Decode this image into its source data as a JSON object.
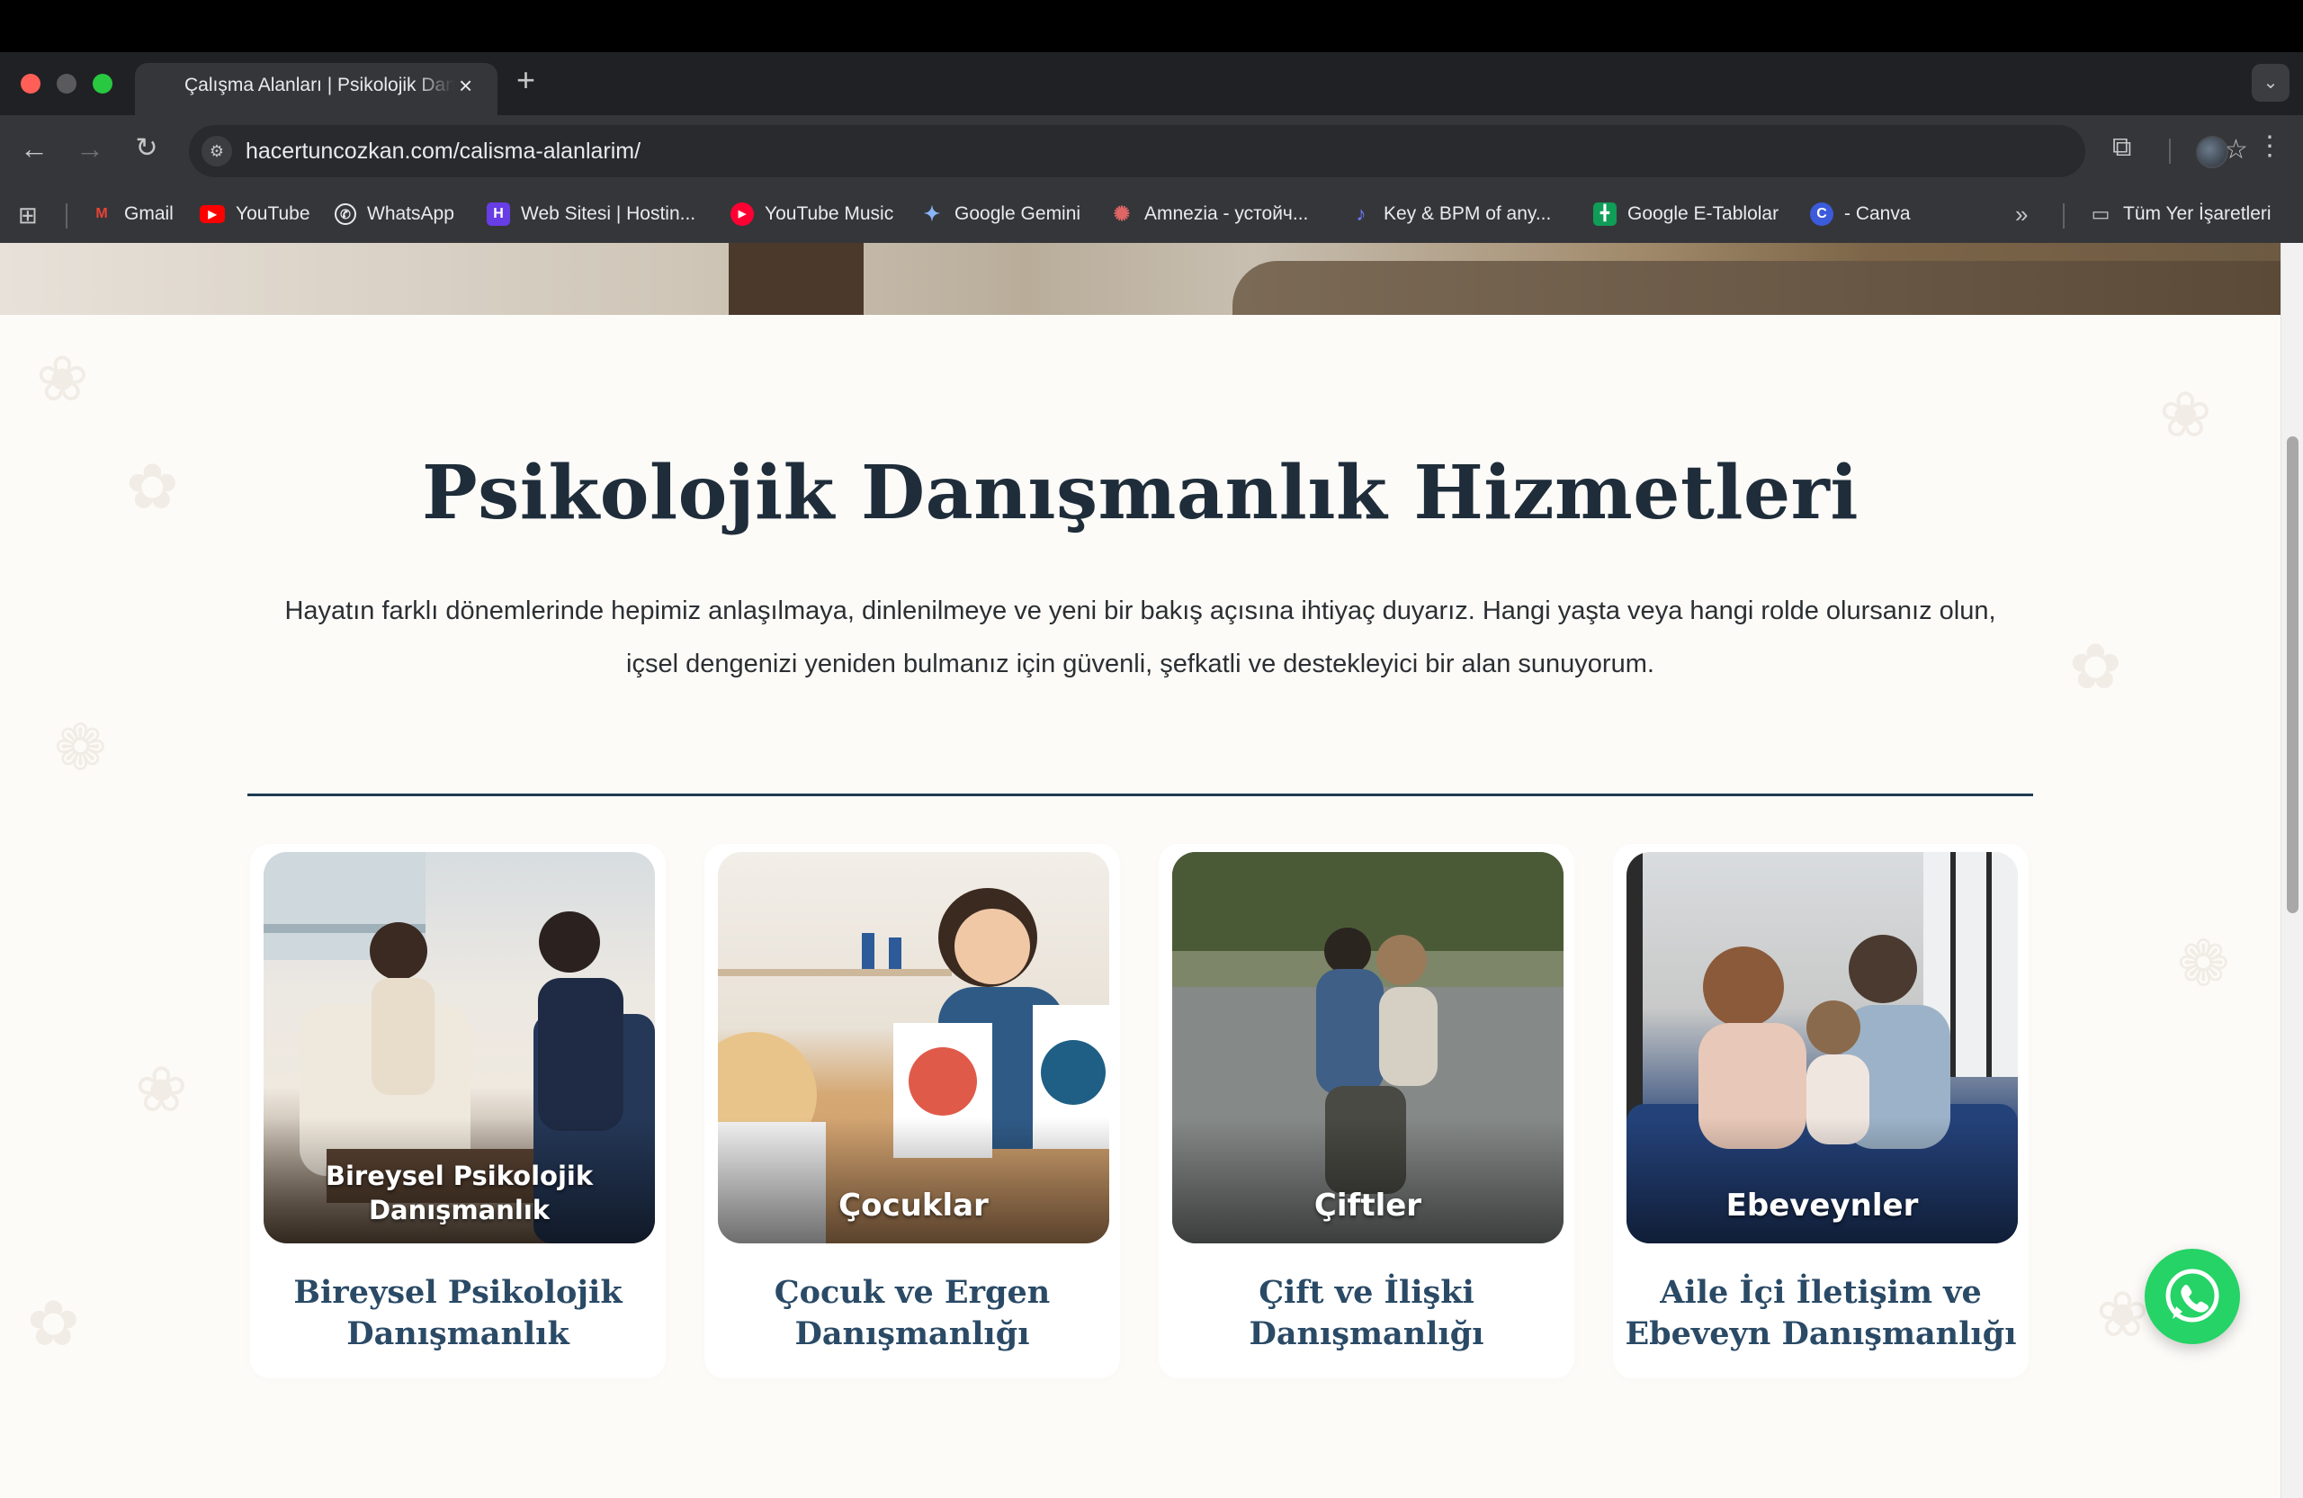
{
  "browser": {
    "tab_title": "Çalışma Alanları | Psikolojik Danışmanlık",
    "tab_close": "×",
    "new_tab": "+",
    "url_host": "hacertuncozkan.com",
    "url_path": "/calisma-alanlarim/",
    "bookmarks": [
      {
        "label": "Gmail",
        "icon": "gmail-icon",
        "color": "#ea4335",
        "glyph": "M"
      },
      {
        "label": "YouTube",
        "icon": "youtube-icon",
        "color": "#ff0000",
        "glyph": "▶"
      },
      {
        "label": "WhatsApp",
        "icon": "whatsapp-icon",
        "color": "#35363a",
        "glyph": "✆"
      },
      {
        "label": "Web Sitesi | Hostin...",
        "icon": "hostinger-icon",
        "color": "#673de6",
        "glyph": "H"
      },
      {
        "label": "YouTube Music",
        "icon": "youtube-music-icon",
        "color": "#ff0033",
        "glyph": "▶"
      },
      {
        "label": "Google Gemini",
        "icon": "gemini-icon",
        "color": "#35363a",
        "glyph": "✦"
      },
      {
        "label": "Amnezia - устойч...",
        "icon": "amnezia-icon",
        "color": "#35363a",
        "glyph": "✺"
      },
      {
        "label": "Key & BPM of any...",
        "icon": "key-bpm-icon",
        "color": "#35363a",
        "glyph": "♪"
      },
      {
        "label": "Google E-Tablolar",
        "icon": "sheets-icon",
        "color": "#0f9d58",
        "glyph": "╋"
      },
      {
        "label": "- Canva",
        "icon": "canva-icon",
        "color": "#3b5bdb",
        "glyph": "C"
      }
    ],
    "bookmarks_overflow": "»",
    "all_bookmarks": "Tüm Yer İşaretleri"
  },
  "page": {
    "title": "Psikolojik Danışmanlık Hizmetleri",
    "description_line1": "Hayatın farklı dönemlerinde hepimiz anlaşılmaya, dinlenilmeye ve yeni bir bakış açısına ihtiyaç duyarız. Hangi yaşta veya hangi rolde olursanız olun,",
    "description_line2": "içsel dengenizi yeniden bulmanız için güvenli, şefkatli ve destekleyici bir alan sunuyorum.",
    "cards": [
      {
        "photo_label_1": "Bireysel Psikolojik",
        "photo_label_2": "Danışmanlık",
        "title_1": "Bireysel Psikolojik",
        "title_2": "Danışmanlık"
      },
      {
        "photo_label_1": "Çocuklar",
        "photo_label_2": "",
        "title_1": "Çocuk ve Ergen",
        "title_2": "Danışmanlığı"
      },
      {
        "photo_label_1": "Çiftler",
        "photo_label_2": "",
        "title_1": "Çift ve İlişki",
        "title_2": "Danışmanlığı"
      },
      {
        "photo_label_1": "Ebeveynler",
        "photo_label_2": "",
        "title_1": "Aile İçi İletişim ve",
        "title_2": "Ebeveyn Danışmanlığı"
      }
    ]
  },
  "colors": {
    "title": "#1f2d3a",
    "card_title": "#2a4a66",
    "whatsapp": "#25d366"
  }
}
